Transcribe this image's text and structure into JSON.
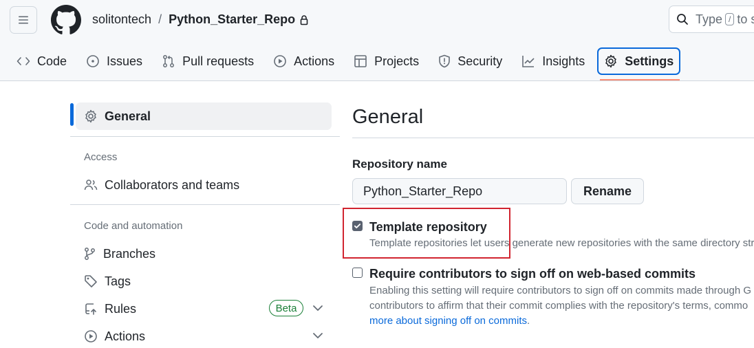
{
  "header": {
    "owner": "solitontech",
    "separator": "/",
    "repo": "Python_Starter_Repo",
    "search_placeholder_start": "Type",
    "search_kbd": "/",
    "search_placeholder_end": "to s"
  },
  "tabs": [
    {
      "label": "Code",
      "icon": "code-icon"
    },
    {
      "label": "Issues",
      "icon": "issue-icon"
    },
    {
      "label": "Pull requests",
      "icon": "pull-request-icon"
    },
    {
      "label": "Actions",
      "icon": "play-icon"
    },
    {
      "label": "Projects",
      "icon": "table-icon"
    },
    {
      "label": "Security",
      "icon": "shield-icon"
    },
    {
      "label": "Insights",
      "icon": "graph-icon"
    },
    {
      "label": "Settings",
      "icon": "gear-icon",
      "selected": true
    }
  ],
  "sidebar": {
    "general": "General",
    "access_heading": "Access",
    "collaborators": "Collaborators and teams",
    "code_heading": "Code and automation",
    "branches": "Branches",
    "tags": "Tags",
    "rules": "Rules",
    "rules_badge": "Beta",
    "actions": "Actions"
  },
  "main": {
    "title": "General",
    "repo_name_label": "Repository name",
    "repo_name_value": "Python_Starter_Repo",
    "rename_label": "Rename",
    "template": {
      "checked": true,
      "title": "Template repository",
      "desc": "Template repositories let users generate new repositories with the same directory stru"
    },
    "signoff": {
      "checked": false,
      "title": "Require contributors to sign off on web-based commits",
      "desc_line1": "Enabling this setting will require contributors to sign off on commits made through G",
      "desc_line2": "contributors to affirm that their commit complies with the repository's terms, commo",
      "link": "more about signing off on commits",
      "link_suffix": "."
    }
  },
  "colors": {
    "accent": "#0969da",
    "tab_underline": "#fd8c73",
    "highlight": "#d1242f",
    "beta": "#1a7f37"
  }
}
